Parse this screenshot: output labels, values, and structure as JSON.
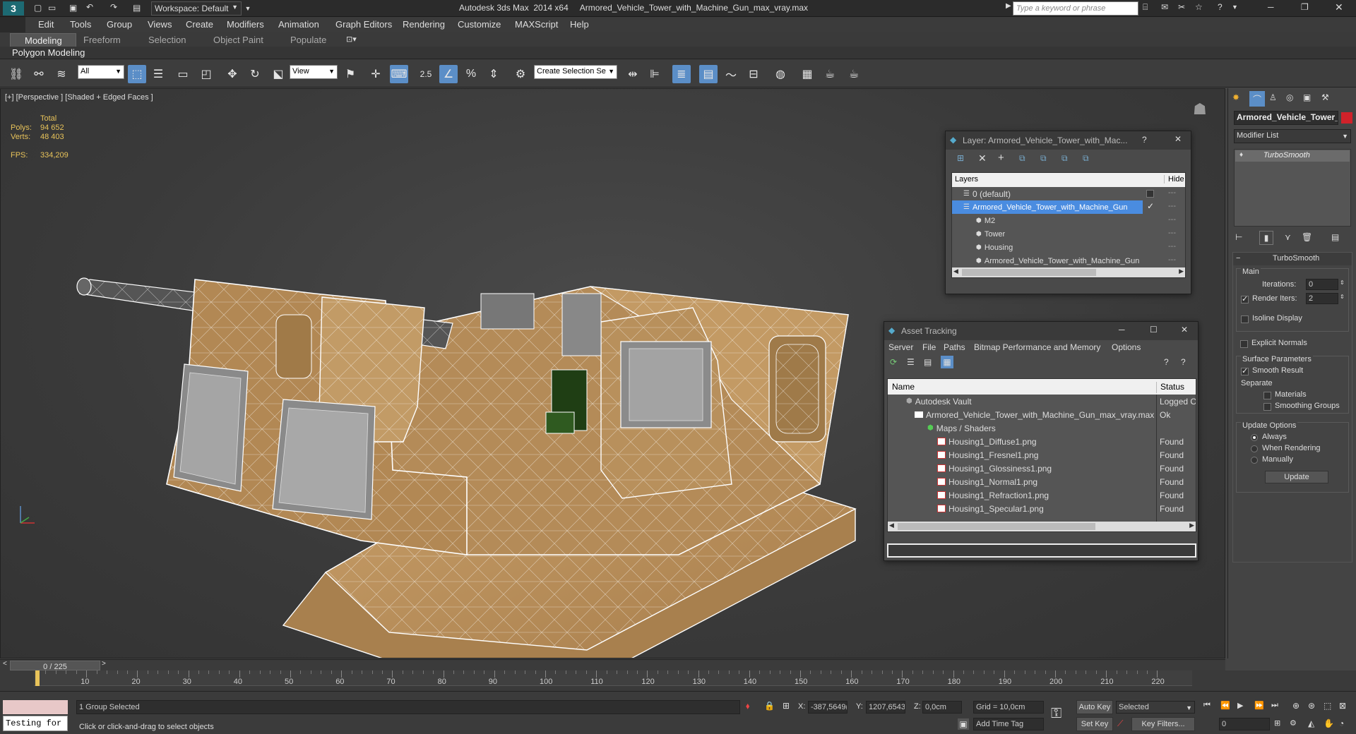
{
  "window": {
    "workspace_label": "Workspace: Default",
    "title": "Autodesk 3ds Max  2014 x64     Armored_Vehicle_Tower_with_Machine_Gun_max_vray.max",
    "search_placeholder": "Type a keyword or phrase"
  },
  "menu": [
    "Edit",
    "Tools",
    "Group",
    "Views",
    "Create",
    "Modifiers",
    "Animation",
    "Graph Editors",
    "Rendering",
    "Customize",
    "MAXScript",
    "Help"
  ],
  "ribbon": {
    "tabs": [
      "Modeling",
      "Freeform",
      "Selection",
      "Object Paint",
      "Populate"
    ],
    "active_tab": "Modeling",
    "sub_label": "Polygon Modeling"
  },
  "toolbar": {
    "filter_value": "All",
    "view_value": "View",
    "selection_set_value": "Create Selection Se"
  },
  "viewport": {
    "label": "[+] [Perspective ] [Shaded + Edged Faces ]",
    "stats": {
      "header": "Total",
      "polys_label": "Polys:",
      "polys_value": "94 652",
      "verts_label": "Verts:",
      "verts_value": "48 403",
      "fps_label": "FPS:",
      "fps_value": "334,209"
    }
  },
  "layer_dialog": {
    "title": "Layer: Armored_Vehicle_Tower_with_Mac...",
    "col_layers": "Layers",
    "col_hide": "Hide",
    "rows": [
      {
        "label": "0 (default)",
        "indent": 0
      },
      {
        "label": "Armored_Vehicle_Tower_with_Machine_Gun",
        "indent": 0
      },
      {
        "label": "M2",
        "indent": 1
      },
      {
        "label": "Tower",
        "indent": 1
      },
      {
        "label": "Housing",
        "indent": 1
      },
      {
        "label": "Armored_Vehicle_Tower_with_Machine_Gun",
        "indent": 1
      }
    ]
  },
  "asset_dialog": {
    "title": "Asset Tracking",
    "menu": [
      "Server",
      "File",
      "Paths",
      "Bitmap Performance and Memory",
      "Options"
    ],
    "col_name": "Name",
    "col_status": "Status",
    "rows": [
      {
        "name": "Autodesk Vault",
        "status": "Logged O",
        "indent": 0
      },
      {
        "name": "Armored_Vehicle_Tower_with_Machine_Gun_max_vray.max",
        "status": "Ok",
        "indent": 1
      },
      {
        "name": "Maps / Shaders",
        "status": "",
        "indent": 2
      },
      {
        "name": "Housing1_Diffuse1.png",
        "status": "Found",
        "indent": 3
      },
      {
        "name": "Housing1_Fresnel1.png",
        "status": "Found",
        "indent": 3
      },
      {
        "name": "Housing1_Glossiness1.png",
        "status": "Found",
        "indent": 3
      },
      {
        "name": "Housing1_Normal1.png",
        "status": "Found",
        "indent": 3
      },
      {
        "name": "Housing1_Refraction1.png",
        "status": "Found",
        "indent": 3
      },
      {
        "name": "Housing1_Specular1.png",
        "status": "Found",
        "indent": 3
      }
    ]
  },
  "command_panel": {
    "object_name": "Armored_Vehicle_Tower_",
    "modifier_list": "Modifier List",
    "stack_item": "TurboSmooth",
    "rollout_title": "TurboSmooth",
    "main_label": "Main",
    "iterations_label": "Iterations:",
    "iterations_value": "0",
    "render_iters_label": "Render Iters:",
    "render_iters_value": "2",
    "isoline_label": "Isoline Display",
    "explicit_normals_label": "Explicit Normals",
    "surface_params_label": "Surface Parameters",
    "smooth_result_label": "Smooth Result",
    "separate_label": "Separate",
    "materials_label": "Materials",
    "smoothing_groups_label": "Smoothing Groups",
    "update_options_label": "Update Options",
    "always_label": "Always",
    "when_rendering_label": "When Rendering",
    "manually_label": "Manually",
    "update_button": "Update"
  },
  "timeline": {
    "frame_label": "0 / 225",
    "ticks": [
      "10",
      "20",
      "30",
      "40",
      "50",
      "60",
      "70",
      "80",
      "90",
      "100",
      "110",
      "120",
      "130",
      "140",
      "150",
      "160",
      "170",
      "180",
      "190",
      "200",
      "210",
      "220"
    ]
  },
  "status": {
    "script_text": "Testing for ;",
    "selection_text": "1 Group Selected",
    "prompt_text": "Click or click-and-drag to select objects",
    "x_label": "X:",
    "x_value": "-387,5649(",
    "y_label": "Y:",
    "y_value": "1207,6543",
    "z_label": "Z:",
    "z_value": "0,0cm",
    "grid_text": "Grid = 10,0cm",
    "add_time_tag": "Add Time Tag",
    "auto_key": "Auto Key",
    "set_key": "Set Key",
    "selected_value": "Selected",
    "key_filters": "Key Filters...",
    "frame_value": "0"
  }
}
